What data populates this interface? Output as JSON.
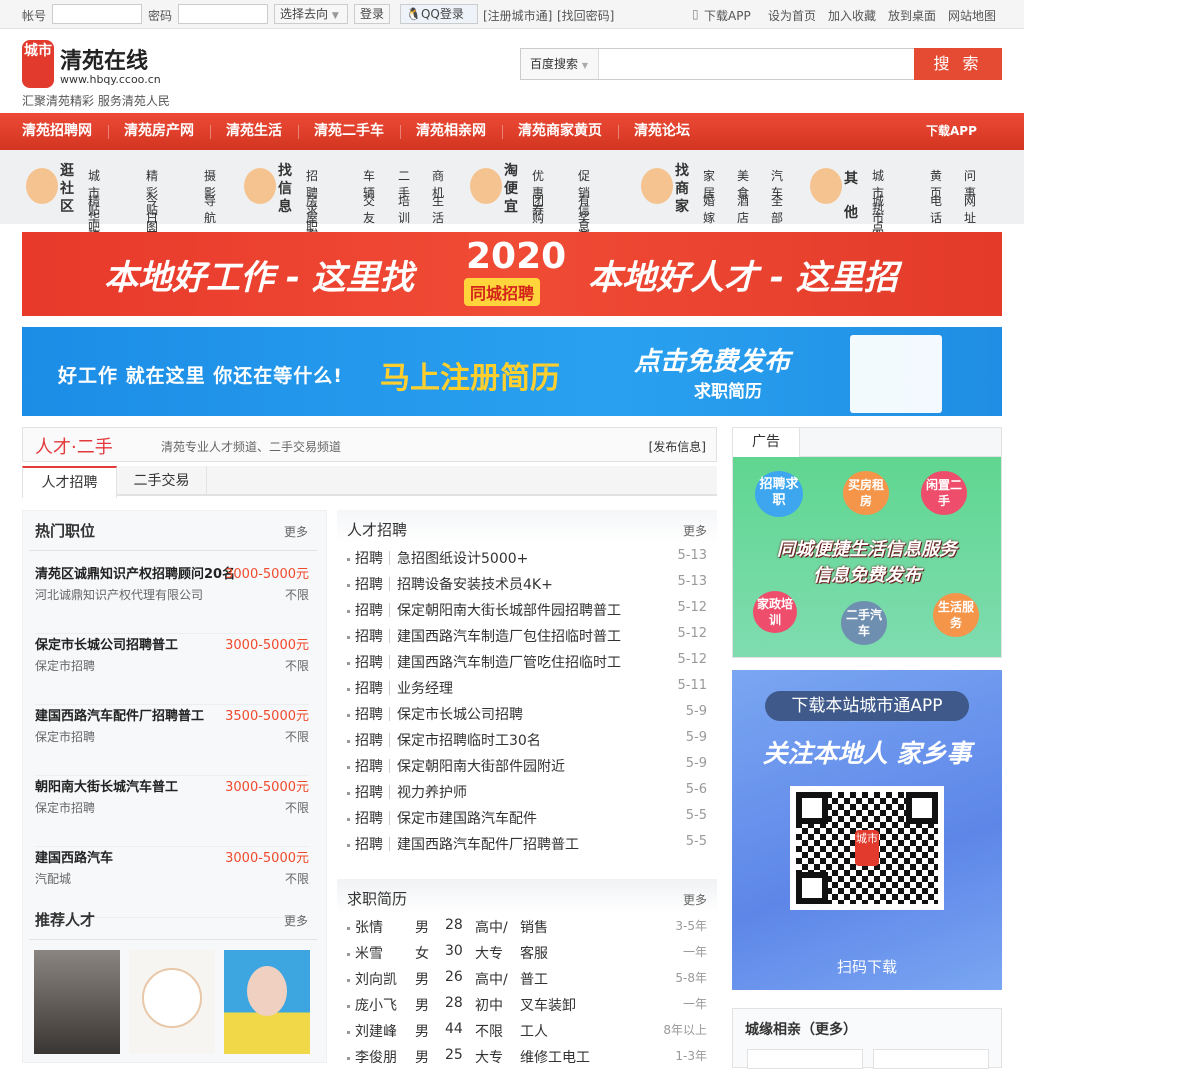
{
  "topbar": {
    "account_label": "帐号",
    "password_label": "密码",
    "direction_select": "选择去向",
    "login": "登录",
    "qq_login": "QQ登录",
    "register": "[注册城市通]",
    "find_password": "[找回密码]",
    "download_app": "下载APP",
    "set_home": "设为首页",
    "add_fav": "加入收藏",
    "to_desktop": "放到桌面",
    "sitemap": "网站地图"
  },
  "header": {
    "logo_badge": "城市",
    "logo_title": "清苑在线",
    "logo_url": "www.hbqy.ccoo.cn",
    "slogan": "汇聚清苑精彩 服务清苑人民",
    "search_engine": "百度搜索",
    "search_placeholder": "",
    "search_button": "搜 索"
  },
  "nav": {
    "items": [
      "清苑招聘网",
      "清苑房产网",
      "清苑生活",
      "清苑二手车",
      "清苑相亲网",
      "清苑商家黄页",
      "清苑论坛"
    ],
    "download": "下载APP"
  },
  "categories": [
    {
      "title": "逛社区",
      "links": [
        "城市贴吧",
        "精彩贴图",
        "摄影",
        "精华热帖",
        "今日关注",
        "导航"
      ]
    },
    {
      "title": "找信息",
      "links": [
        "招聘求职",
        "车辆",
        "二手",
        "商机",
        "房屋交易",
        "交友",
        "培训",
        "生活"
      ]
    },
    {
      "title": "淘便宜",
      "links": [
        "优惠券",
        "促销信息",
        "团　购",
        "有奖参与"
      ]
    },
    {
      "title": "找商家",
      "links": [
        "家居",
        "美食",
        "汽车",
        "婚嫁",
        "酒店",
        "全部"
      ]
    },
    {
      "title": "其他",
      "links": [
        "城市热点",
        "黄页",
        "问事",
        "城市百科",
        "电话",
        "网址"
      ]
    }
  ],
  "banner1": {
    "left": "本地好工作 - 这里找",
    "year": "2020",
    "tag": "同城招聘",
    "right": "本地好人才 - 这里招"
  },
  "banner2": {
    "left": "好工作 就在这里 你还在等什么!",
    "middle": "马上注册简历",
    "right_title": "点击免费发布",
    "right_sub": "求职简历"
  },
  "section": {
    "title": "人才·二手",
    "subtitle": "清苑专业人才频道、二手交易频道",
    "publish": "[发布信息]",
    "tabs": [
      "人才招聘",
      "二手交易"
    ]
  },
  "hot_jobs": {
    "title": "热门职位",
    "more": "更多",
    "items": [
      {
        "name": "清苑区诚鼎知识产权招聘顾问20名",
        "salary": "3000-5000元",
        "company": "河北诚鼎知识产权代理有限公司",
        "req": "不限"
      },
      {
        "name": "保定市长城公司招聘普工",
        "salary": "3000-5000元",
        "company": "保定市招聘",
        "req": "不限"
      },
      {
        "name": "建国西路汽车配件厂招聘普工",
        "salary": "3500-5000元",
        "company": "保定市招聘",
        "req": "不限"
      },
      {
        "name": "朝阳南大街长城汽车普工",
        "salary": "3000-5000元",
        "company": "保定市招聘",
        "req": "不限"
      },
      {
        "name": "建国西路汽车",
        "salary": "3000-5000元",
        "company": "汽配城",
        "req": "不限"
      }
    ]
  },
  "talent": {
    "title": "推荐人才",
    "more": "更多"
  },
  "recruit": {
    "title": "人才招聘",
    "more": "更多",
    "tag": "招聘",
    "items": [
      {
        "t": "急招图纸设计5000+",
        "d": "5-13"
      },
      {
        "t": "招聘设备安装技术员4K+",
        "d": "5-13"
      },
      {
        "t": "保定朝阳南大街长城部件园招聘普工",
        "d": "5-12"
      },
      {
        "t": "建国西路汽车制造厂包住招临时普工",
        "d": "5-12"
      },
      {
        "t": "建国西路汽车制造厂管吃住招临时工",
        "d": "5-12"
      },
      {
        "t": "业务经理",
        "d": "5-11"
      },
      {
        "t": "保定市长城公司招聘",
        "d": "5-9"
      },
      {
        "t": "保定市招聘临时工30名",
        "d": "5-9"
      },
      {
        "t": "保定朝阳南大街部件园附近",
        "d": "5-9"
      },
      {
        "t": "视力养护师",
        "d": "5-6"
      },
      {
        "t": "保定市建国路汽车配件",
        "d": "5-5"
      },
      {
        "t": "建国西路汽车配件厂招聘普工",
        "d": "5-5"
      }
    ]
  },
  "resumes": {
    "title": "求职简历",
    "more": "更多",
    "items": [
      {
        "name": "张情",
        "sex": "男",
        "age": "28",
        "edu": "高中/",
        "job": "销售",
        "exp": "3-5年"
      },
      {
        "name": "米雪",
        "sex": "女",
        "age": "30",
        "edu": "大专",
        "job": "客服",
        "exp": "一年"
      },
      {
        "name": "刘向凯",
        "sex": "男",
        "age": "26",
        "edu": "高中/",
        "job": "普工",
        "exp": "5-8年"
      },
      {
        "name": "庞小飞",
        "sex": "男",
        "age": "28",
        "edu": "初中",
        "job": "叉车装卸",
        "exp": "一年"
      },
      {
        "name": "刘建峰",
        "sex": "男",
        "age": "44",
        "edu": "不限",
        "job": "工人",
        "exp": "8年以上"
      },
      {
        "name": "李俊朋",
        "sex": "男",
        "age": "25",
        "edu": "大专",
        "job": "维修工电工",
        "exp": "1-3年"
      }
    ]
  },
  "ad": {
    "tab": "广告",
    "bubbles": [
      "招聘求职",
      "买房租房",
      "闲置二手",
      "家政培训",
      "二手汽车",
      "生活服务"
    ],
    "line1": "同城便捷生活信息服务",
    "line2": "信息免费发布"
  },
  "app": {
    "pill": "下载本站城市通APP",
    "slogan": "关注本地人 家乡事",
    "qr_badge": "城市",
    "scan": "扫码下载"
  },
  "dating": {
    "title": "城缘相亲（更多）"
  }
}
